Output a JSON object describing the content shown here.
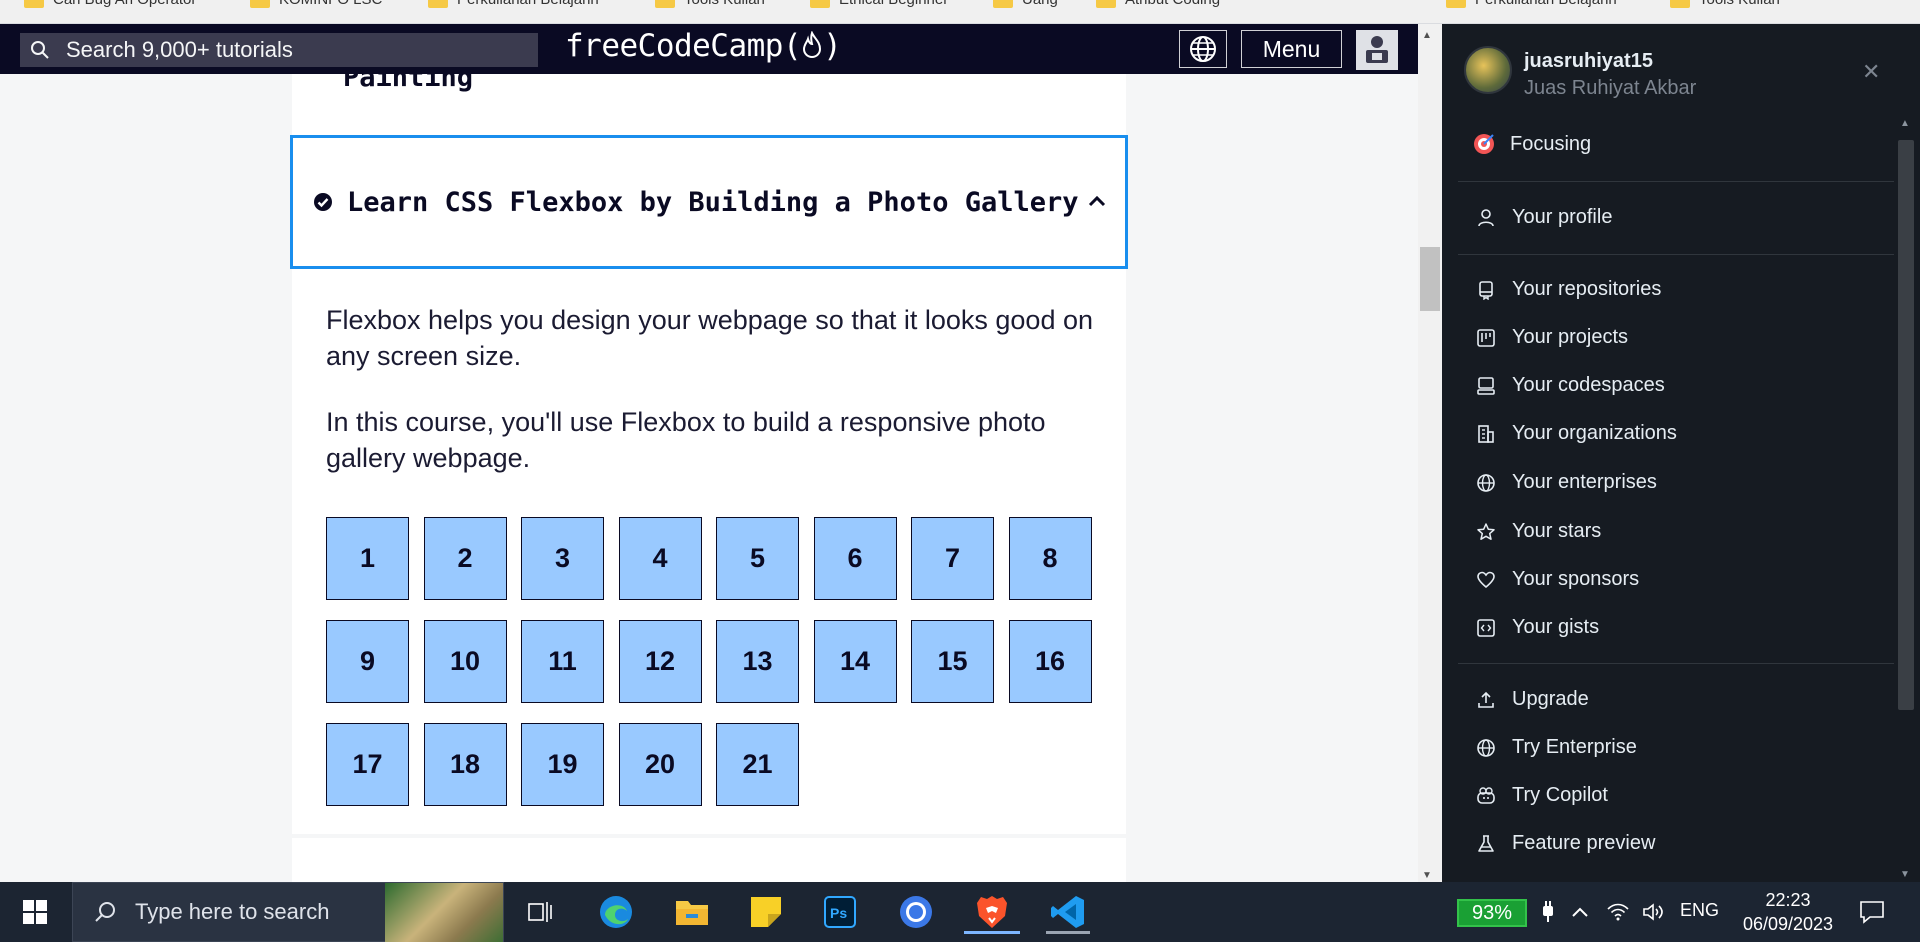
{
  "bookmarks": {
    "items": [
      "Cari Bug Ari Operator",
      "KOMINFO LSC",
      "Perkuliahan Belajarin",
      "Tools Kuliah",
      "Ethical Beginner",
      "Uang",
      "Atribut Coding",
      "Perkuliahan Belajarin",
      "Tools Kuliah"
    ]
  },
  "fcc": {
    "search_placeholder": "Search 9,000+ tutorials",
    "logo": "freeCodeCamp(🔥)",
    "logo_text": "freeCodeCamp(",
    "logo_end": ")",
    "menu_label": "Menu"
  },
  "content": {
    "partial_title": "Painting",
    "block_title": "Learn CSS Flexbox by Building a Photo Gallery",
    "para1": "Flexbox helps you design your webpage so that it looks good on any screen size.",
    "para2": "In this course, you'll use Flexbox to build a responsive photo gallery webpage.",
    "steps": [
      "1",
      "2",
      "3",
      "4",
      "5",
      "6",
      "7",
      "8",
      "9",
      "10",
      "11",
      "12",
      "13",
      "14",
      "15",
      "16",
      "17",
      "18",
      "19",
      "20",
      "21"
    ]
  },
  "github": {
    "username": "juasruhiyat15",
    "full_name": "Juas Ruhiyat Akbar",
    "status": "Focusing",
    "menu_items": [
      {
        "label": "Your profile",
        "icon": "person-icon"
      },
      {
        "label": "Your repositories",
        "icon": "repo-icon"
      },
      {
        "label": "Your projects",
        "icon": "project-icon"
      },
      {
        "label": "Your codespaces",
        "icon": "codespaces-icon"
      },
      {
        "label": "Your organizations",
        "icon": "organization-icon"
      },
      {
        "label": "Your enterprises",
        "icon": "globe-icon"
      },
      {
        "label": "Your stars",
        "icon": "star-icon"
      },
      {
        "label": "Your sponsors",
        "icon": "heart-icon"
      },
      {
        "label": "Your gists",
        "icon": "code-square-icon"
      },
      {
        "label": "Upgrade",
        "icon": "upload-icon"
      },
      {
        "label": "Try Enterprise",
        "icon": "globe-icon"
      },
      {
        "label": "Try Copilot",
        "icon": "copilot-icon"
      },
      {
        "label": "Feature preview",
        "icon": "beaker-icon"
      }
    ]
  },
  "taskbar": {
    "search_placeholder": "Type here to search",
    "battery": "93%",
    "language": "ENG",
    "time": "22:23",
    "date": "06/09/2023"
  },
  "colors": {
    "fcc_nav": "#0a0a23",
    "block_border": "#198eee",
    "step_fill": "#99c9ff",
    "github_bg": "#161b22",
    "taskbar_bg": "#1c2532",
    "battery_green": "#1aa034"
  }
}
